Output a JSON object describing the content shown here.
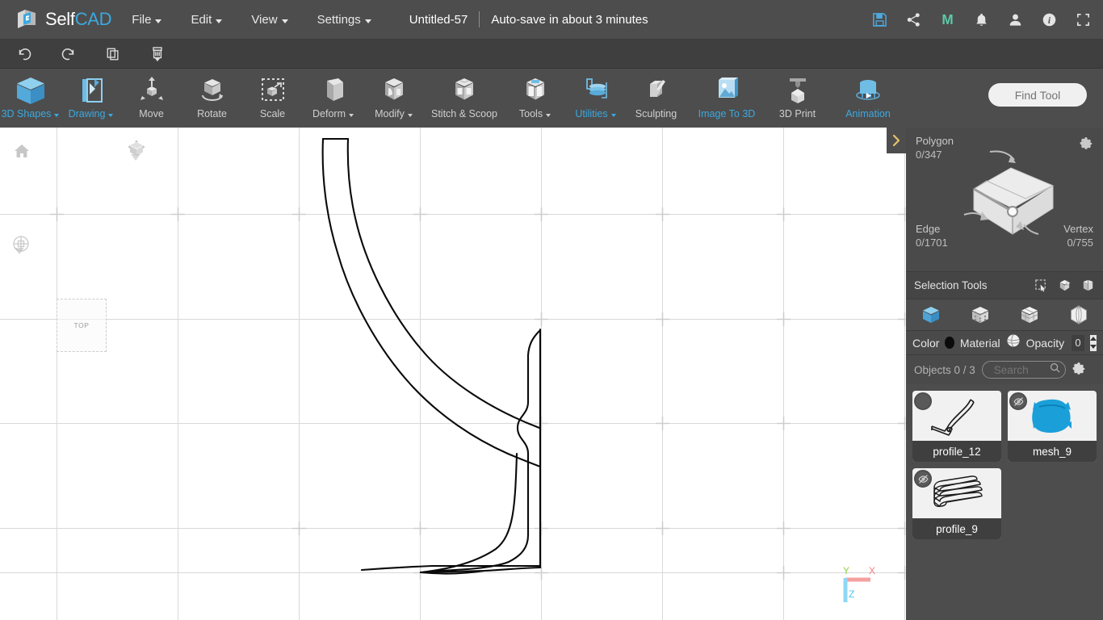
{
  "app": {
    "brand_self": "Self",
    "brand_cad": "CAD",
    "logo_icon": "selfcad-cube-logo"
  },
  "menubar": {
    "items": [
      {
        "label": "File",
        "caret": true,
        "name": "menu-file"
      },
      {
        "label": "Edit",
        "caret": true,
        "name": "menu-edit"
      },
      {
        "label": "View",
        "caret": true,
        "name": "menu-view"
      },
      {
        "label": "Settings",
        "caret": true,
        "name": "menu-settings"
      }
    ],
    "document_title": "Untitled-57",
    "autosave_text": "Auto-save in about 3 minutes",
    "right_icons": [
      {
        "name": "save-icon",
        "title": "Save"
      },
      {
        "name": "share-icon",
        "title": "Share"
      },
      {
        "name": "my-models-icon",
        "title": "M"
      },
      {
        "name": "notifications-bell-icon",
        "title": "Notifications"
      },
      {
        "name": "user-account-icon",
        "title": "Account"
      },
      {
        "name": "info-icon",
        "title": "Info"
      },
      {
        "name": "fullscreen-icon",
        "title": "Fullscreen"
      }
    ]
  },
  "undobar": {
    "buttons": [
      {
        "name": "undo-button",
        "icon": "undo-arrow-icon"
      },
      {
        "name": "redo-button",
        "icon": "redo-arrow-icon"
      },
      {
        "name": "copy-button",
        "icon": "copy-icon"
      },
      {
        "name": "delete-button",
        "icon": "trash-icon"
      }
    ]
  },
  "toolbar": {
    "tools": [
      {
        "label": "3D Shapes",
        "icon": "blue-cube-icon",
        "caret": true,
        "accent": true
      },
      {
        "label": "Drawing",
        "icon": "drawing-pen-icon",
        "caret": true,
        "accent": true
      },
      {
        "label": "Move",
        "icon": "move-arrows-icon",
        "caret": false,
        "accent": false
      },
      {
        "label": "Rotate",
        "icon": "rotate-cube-icon",
        "caret": false,
        "accent": false
      },
      {
        "label": "Scale",
        "icon": "scale-marquee-icon",
        "caret": false,
        "accent": false
      },
      {
        "label": "Deform",
        "icon": "deform-cube-icon",
        "caret": true,
        "accent": false
      },
      {
        "label": "Modify",
        "icon": "modify-cube-icon",
        "caret": true,
        "accent": false
      },
      {
        "label": "Stitch & Scoop",
        "icon": "stitch-scoop-cube-icon",
        "caret": false,
        "accent": false
      },
      {
        "label": "Tools",
        "icon": "tools-cube-icon",
        "caret": true,
        "accent": false
      },
      {
        "label": "Utilities",
        "icon": "utilities-stack-icon",
        "caret": true,
        "accent": true
      },
      {
        "label": "Sculpting",
        "icon": "sculpting-chisel-icon",
        "caret": false,
        "accent": false
      },
      {
        "label": "Image To 3D",
        "icon": "image-to-3d-icon",
        "caret": false,
        "accent": true
      },
      {
        "label": "3D Print",
        "icon": "3d-print-icon",
        "caret": false,
        "accent": false
      },
      {
        "label": "Animation",
        "icon": "animation-elephant-icon",
        "caret": false,
        "accent": true
      }
    ],
    "find_tool_placeholder": "Find Tool"
  },
  "viewport": {
    "view_label": "TOP",
    "home_icon": "home-icon",
    "view_cube_icon": "view-cube-icon",
    "grid_settings_icon": "grid-snap-icon",
    "axis_gizmo": {
      "x": "X",
      "y": "Y",
      "z": "Z",
      "x_color": "#f08080",
      "y_color": "#8ed14a",
      "z_color": "#6fd4f5"
    },
    "grid": {
      "vertical_lines": [
        70,
        220,
        370,
        520,
        670,
        820,
        970,
        1120
      ],
      "horizontal_lines": [
        107,
        237,
        366,
        496,
        552
      ],
      "line_color": "#d6d6d6"
    },
    "collapse_arrow_icon": "chevron-right-icon"
  },
  "selection_info": {
    "polygon_label": "Polygon",
    "polygon_value": "0/347",
    "edge_label": "Edge",
    "edge_value": "0/1701",
    "vertex_label": "Vertex",
    "vertex_value": "0/755",
    "gear_icon": "gear-icon"
  },
  "selection_tools": {
    "label": "Selection Tools",
    "icons": [
      {
        "name": "rectangle-select-icon"
      },
      {
        "name": "box-select-icon"
      },
      {
        "name": "loop-select-icon"
      }
    ]
  },
  "mode_row": {
    "buttons": [
      {
        "name": "object-mode-button",
        "icon": "blue-solid-cube-icon",
        "active": true
      },
      {
        "name": "vertex-mode-button",
        "icon": "vertex-cube-icon",
        "active": false
      },
      {
        "name": "face-mode-button",
        "icon": "face-cube-icon",
        "active": false
      },
      {
        "name": "edge-mode-button",
        "icon": "edge-sphere-icon",
        "active": false
      }
    ]
  },
  "material_row": {
    "color_label": "Color",
    "color_value": "#0b0b0b",
    "material_label": "Material",
    "material_icon": "material-sphere-icon",
    "opacity_label": "Opacity",
    "opacity_value": "0"
  },
  "objects": {
    "header_label": "Objects 0 / 3",
    "search_placeholder": "Search",
    "search_value": "",
    "search_icon": "search-icon",
    "gear_icon": "gear-icon",
    "items": [
      {
        "name": "profile_12",
        "thumb": "profile-curve-thumb",
        "badge": "unselected-circle",
        "visible": true
      },
      {
        "name": "mesh_9",
        "thumb": "blue-mesh-thumb",
        "badge": "hidden-eye-icon",
        "visible": false
      },
      {
        "name": "profile_9",
        "thumb": "profile-stack-thumb",
        "badge": "hidden-eye-icon",
        "visible": false
      }
    ]
  },
  "colors": {
    "accent_blue": "#3ba9e0",
    "panel_bg": "#4d4d4d",
    "menubar_bg": "#4d4d4d",
    "undobar_bg": "#3f3f3f",
    "viewport_bg": "#ffffff"
  }
}
